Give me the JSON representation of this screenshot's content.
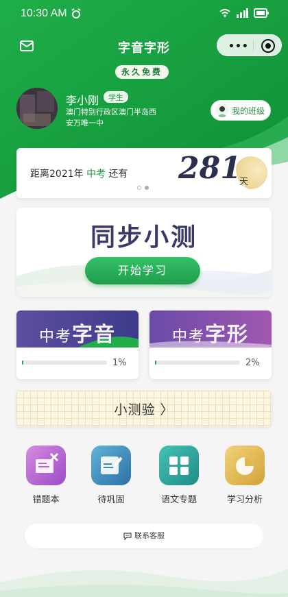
{
  "status_bar": {
    "time": "10:30 AM"
  },
  "navbar": {
    "title": "字音字形",
    "capsule_dots": "•••"
  },
  "badge": {
    "free": "永久免费"
  },
  "profile": {
    "name": "李小刚",
    "role": "学生",
    "school": "澳门特别行政区澳门半岛西安万唯一中",
    "class_button": "我的班级"
  },
  "countdown": {
    "prefix": "距离2021年",
    "exam": "中考",
    "suffix": "还有",
    "days": "281",
    "unit": "天"
  },
  "sync_test": {
    "title": "同步小测",
    "start_button": "开始学习"
  },
  "cards": [
    {
      "prefix": "中考",
      "subject": "字音",
      "progress_text": "1%",
      "progress": 0.01
    },
    {
      "prefix": "中考",
      "subject": "字形",
      "progress_text": "2%",
      "progress": 0.02
    }
  ],
  "quiz": {
    "label": "小测验 〉"
  },
  "tools": [
    {
      "label": "错题本",
      "icon": "wrong-notebook-icon",
      "color": "#b45fd0"
    },
    {
      "label": "待巩固",
      "icon": "edit-card-icon",
      "color": "#3f8fbe"
    },
    {
      "label": "语文专题",
      "icon": "grid-icon",
      "color": "#2aa9a0"
    },
    {
      "label": "学习分析",
      "icon": "pie-chart-icon",
      "color": "#e0b546"
    }
  ],
  "service": {
    "label": "联系客服"
  },
  "colors": {
    "brand_green": "#1f9e4b",
    "dark_navy": "#2a2f4e"
  }
}
